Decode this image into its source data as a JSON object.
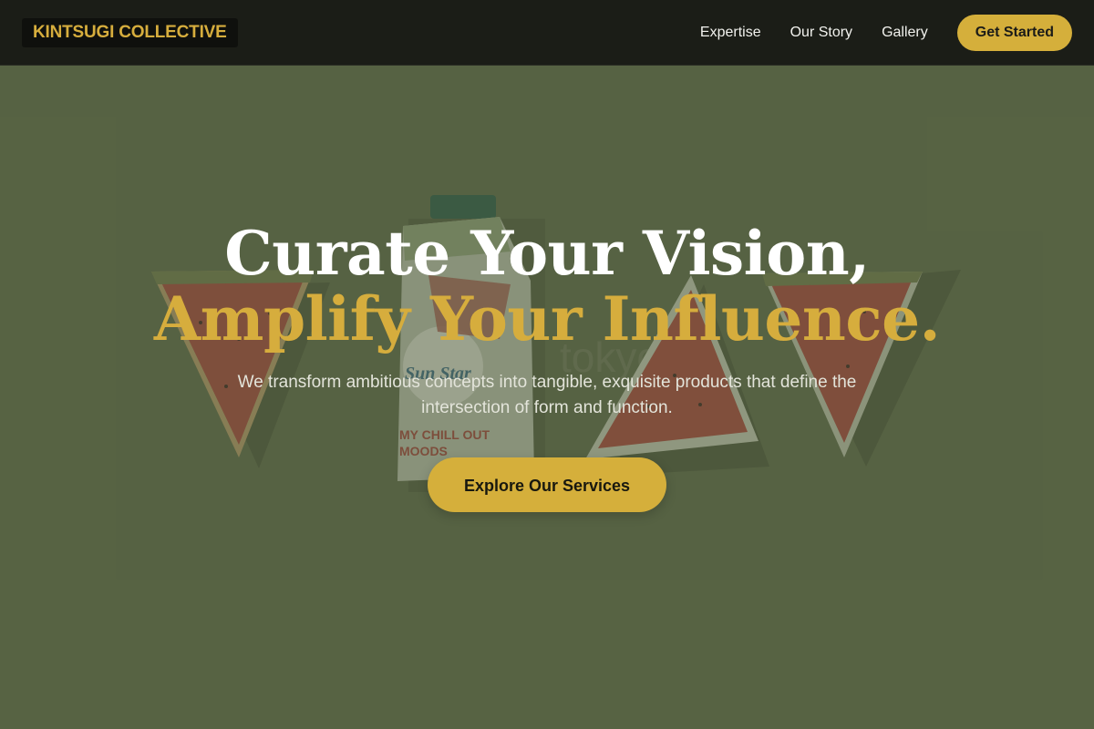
{
  "brand": {
    "logo_text": "KINTSUGI COLLECTIVE"
  },
  "nav": {
    "links": [
      {
        "label": "Expertise"
      },
      {
        "label": "Our Story"
      },
      {
        "label": "Gallery"
      }
    ],
    "cta_label": "Get Started"
  },
  "hero": {
    "headline_line1": "Curate Your Vision,",
    "headline_line2": "Amplify Your Influence.",
    "subtitle": "We transform ambitious concepts into tangible, exquisite products that define the intersection of form and function.",
    "cta_label": "Explore Our Services",
    "background_image": {
      "carton_text_brand": "Sun Star",
      "carton_text_slogan": "MY CHILL OUT MOODS",
      "watermark_text": "tokyo"
    }
  },
  "colors": {
    "accent": "#d5af3b",
    "nav_background": "#1b1d17",
    "hero_background": "#5c6849",
    "headline_primary": "#ffffff",
    "headline_accent": "#d6ad3d"
  }
}
